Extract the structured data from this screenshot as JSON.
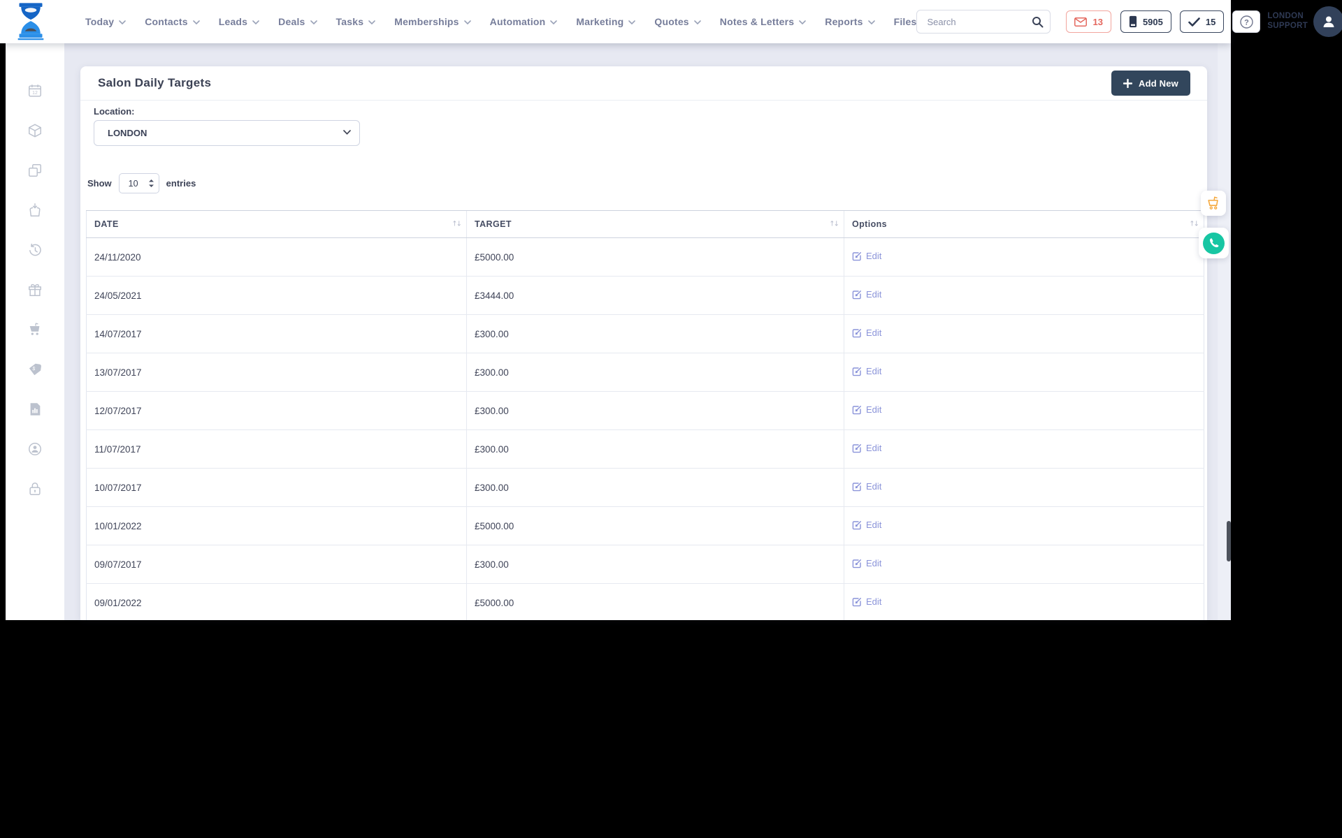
{
  "topbar": {
    "nav": [
      {
        "name": "today",
        "label": "Today",
        "chevron": true
      },
      {
        "name": "contacts",
        "label": "Contacts",
        "chevron": true
      },
      {
        "name": "leads",
        "label": "Leads",
        "chevron": true
      },
      {
        "name": "deals",
        "label": "Deals",
        "chevron": true
      },
      {
        "name": "tasks",
        "label": "Tasks",
        "chevron": true
      },
      {
        "name": "memberships",
        "label": "Memberships",
        "chevron": true
      },
      {
        "name": "automation",
        "label": "Automation",
        "chevron": true
      },
      {
        "name": "marketing",
        "label": "Marketing",
        "chevron": true
      },
      {
        "name": "quotes",
        "label": "Quotes",
        "chevron": true
      },
      {
        "name": "notes-letters",
        "label": "Notes & Letters",
        "chevron": true
      },
      {
        "name": "reports",
        "label": "Reports",
        "chevron": true
      },
      {
        "name": "files",
        "label": "Files",
        "chevron": false
      }
    ],
    "search": {
      "placeholder": "Search"
    },
    "mail_badge_count": "13",
    "phone_badge_value": "5905",
    "tasks_badge_count": "15",
    "user": {
      "line1": "LONDON",
      "line2": "SUPPORT"
    }
  },
  "sidebar": {
    "icons": [
      "calendar-12-icon",
      "package-icon",
      "copy-icon",
      "bag-save-icon",
      "history-icon",
      "gift-icon",
      "cart-icon",
      "price-tag-icon",
      "report-document-icon",
      "account-sync-icon",
      "lock-icon"
    ]
  },
  "page": {
    "title": "Salon Daily Targets",
    "add_new": "Add New",
    "location_label": "Location:",
    "location_value": "LONDON",
    "show_label": "Show",
    "page_size": "10",
    "entries_label": "entries",
    "table": {
      "columns": [
        "DATE",
        "TARGET",
        "Options"
      ],
      "sort_glyph": "↑↓",
      "edit_label": "Edit",
      "rows": [
        {
          "date": "24/11/2020",
          "target": "£5000.00"
        },
        {
          "date": "24/05/2021",
          "target": "£3444.00"
        },
        {
          "date": "14/07/2017",
          "target": "£300.00"
        },
        {
          "date": "13/07/2017",
          "target": "£300.00"
        },
        {
          "date": "12/07/2017",
          "target": "£300.00"
        },
        {
          "date": "11/07/2017",
          "target": "£300.00"
        },
        {
          "date": "10/07/2017",
          "target": "£300.00"
        },
        {
          "date": "10/01/2022",
          "target": "£5000.00"
        },
        {
          "date": "09/07/2017",
          "target": "£300.00"
        },
        {
          "date": "09/01/2022",
          "target": "£5000.00"
        }
      ]
    }
  },
  "colors": {
    "accent_navy": "#32465c",
    "logo_blue_dark": "#1565c6",
    "logo_blue_light": "#2b8fe8",
    "mail_red": "#e4675e",
    "cart_orange": "#f5a83c",
    "phone_teal": "#17c6a3",
    "edit_link": "#8a93d9",
    "background": "#e7e9f2"
  }
}
